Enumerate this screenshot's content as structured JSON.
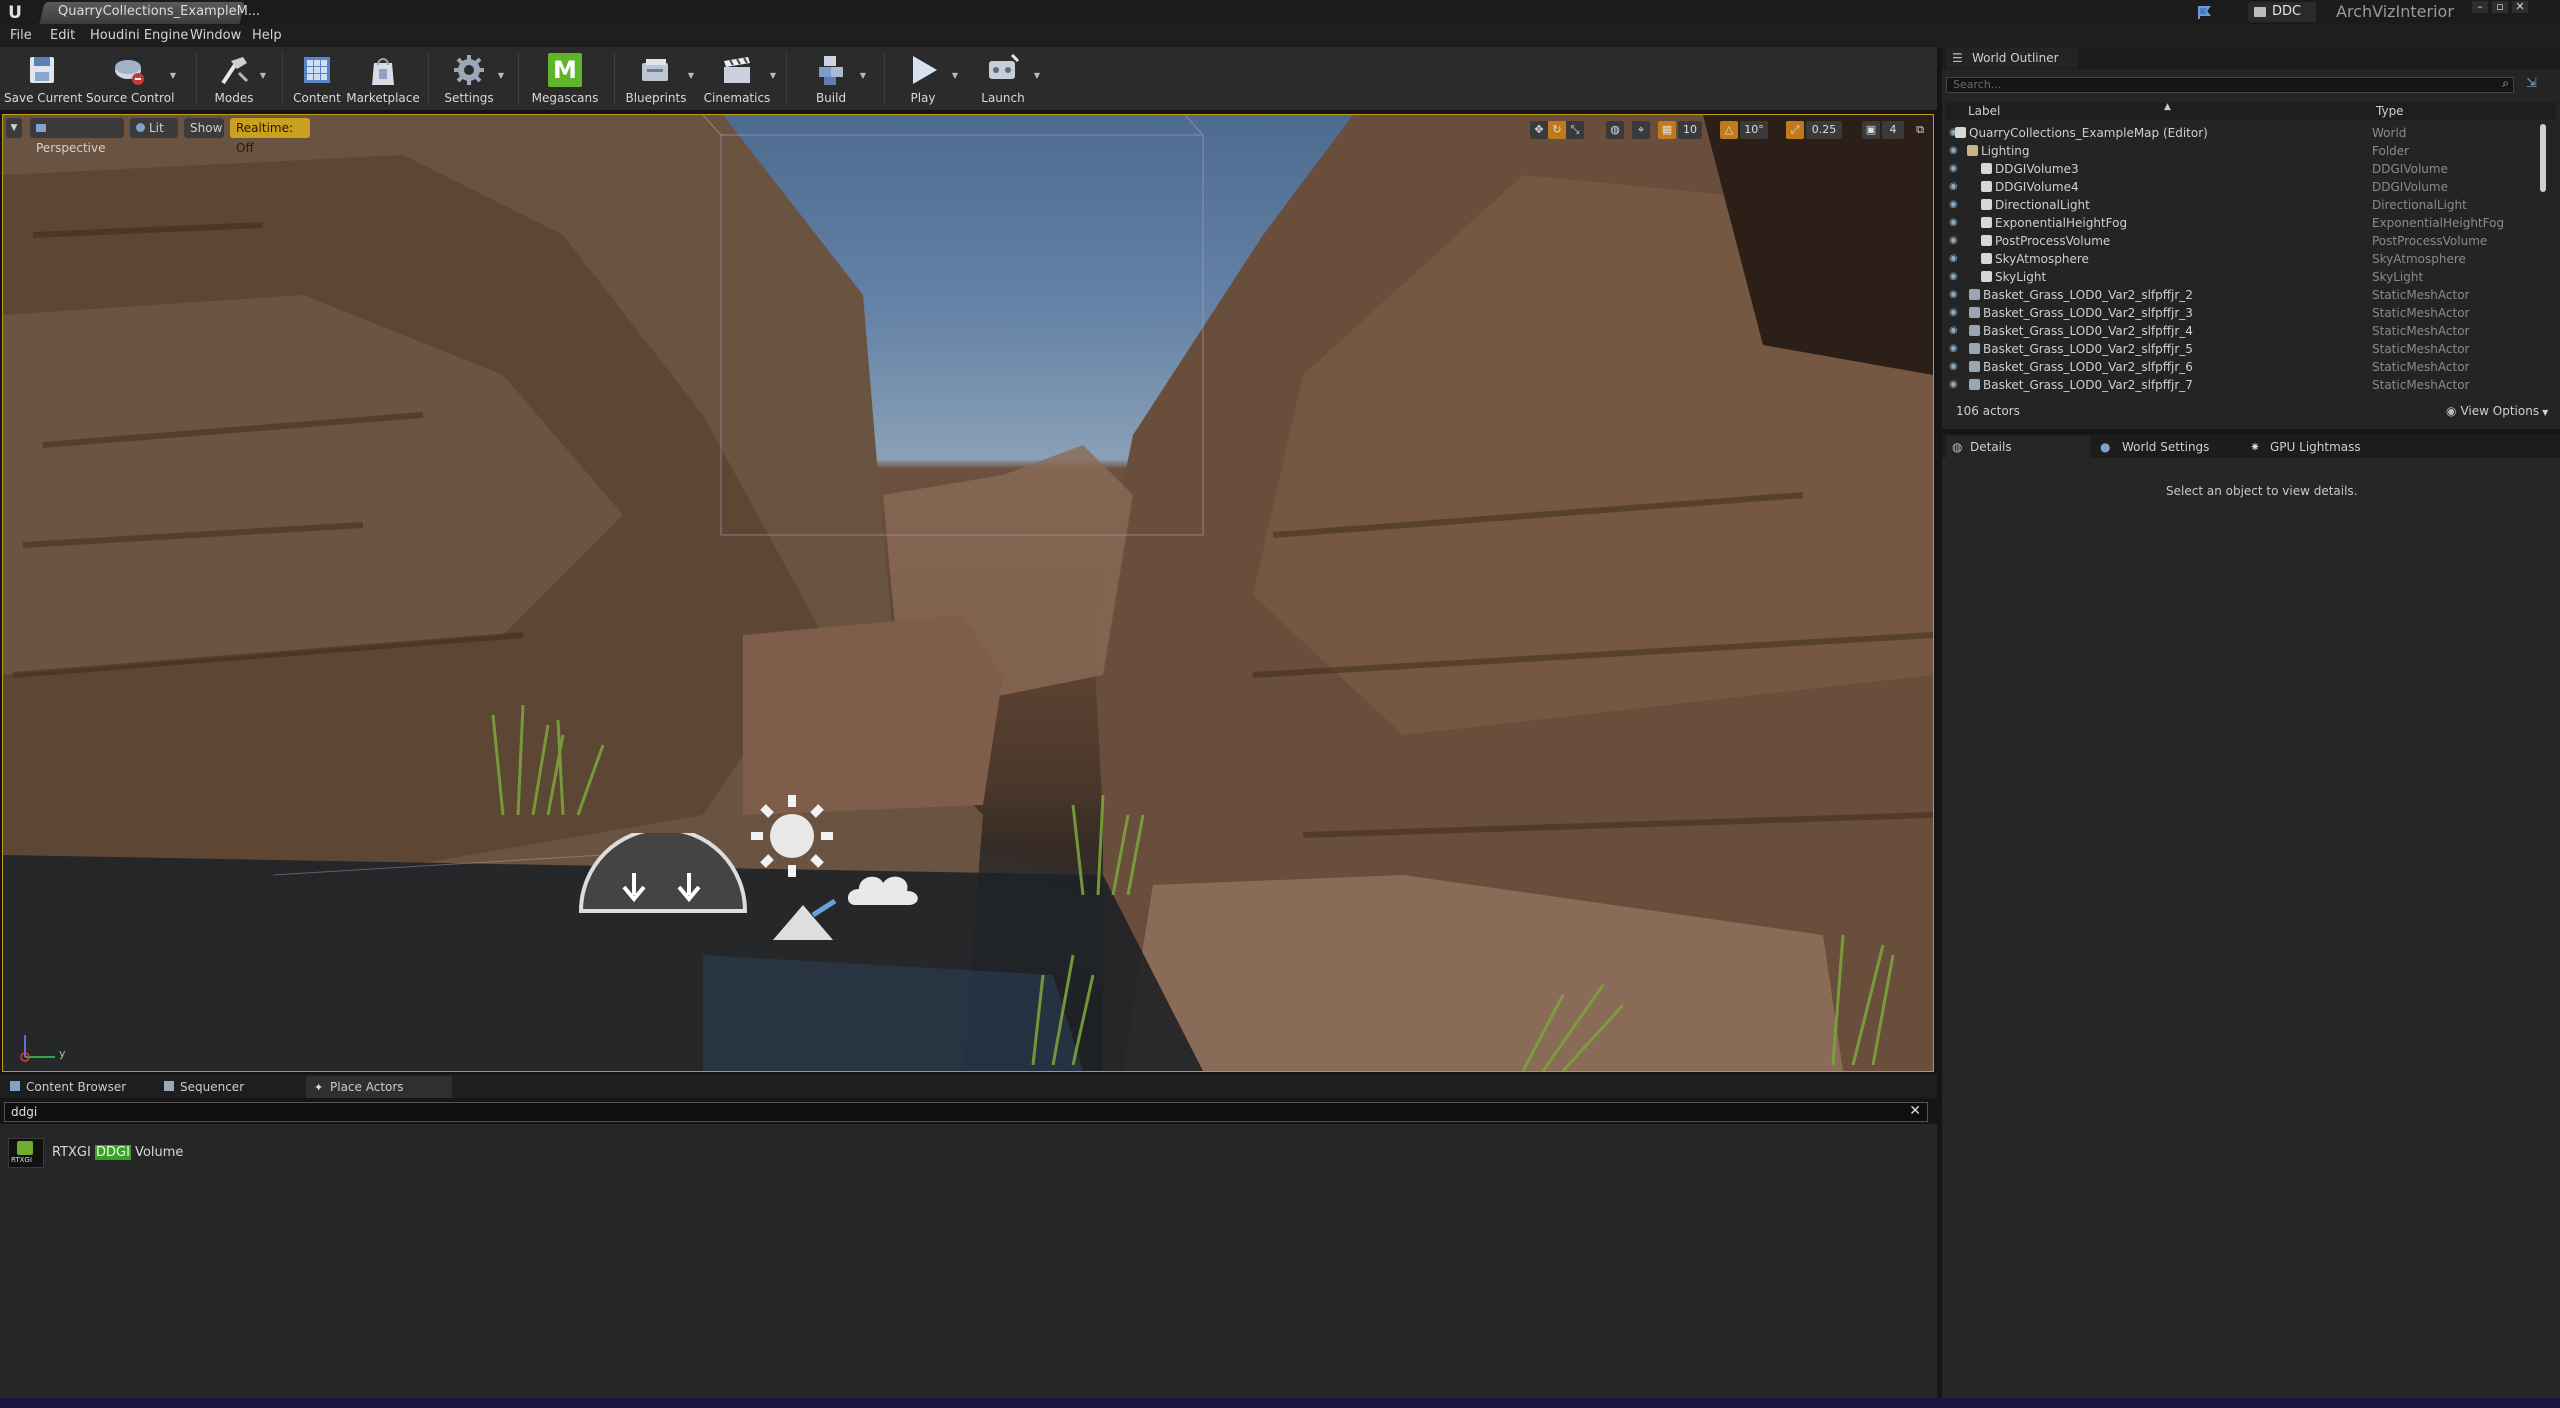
{
  "titlebar": {
    "document_tab": "QuarryCollections_ExampleM...",
    "ddc_label": "DDC",
    "project_name": "ArchVizInterior"
  },
  "menu": [
    "File",
    "Edit",
    "Houdini Engine",
    "Window",
    "Help"
  ],
  "toolbar": {
    "save_current": "Save Current",
    "source_control": "Source Control",
    "modes": "Modes",
    "content": "Content",
    "marketplace": "Marketplace",
    "settings": "Settings",
    "megascans": "Megascans",
    "blueprints": "Blueprints",
    "cinematics": "Cinematics",
    "build": "Build",
    "play": "Play",
    "launch": "Launch"
  },
  "viewport": {
    "perspective": "Perspective",
    "lit": "Lit",
    "show": "Show",
    "realtime": "Realtime: Off",
    "grid_snap": "10",
    "rotation_snap": "10°",
    "scale_snap": "0.25",
    "camera_speed": "4",
    "axis_y": "y"
  },
  "bottom": {
    "tabs": [
      "Content Browser",
      "Sequencer",
      "Place Actors"
    ],
    "search_value": "ddgi",
    "result_prefix": "RTXGI ",
    "result_highlight": "DDGI",
    "result_suffix": " Volume",
    "result_icon_text": "RTXGI"
  },
  "outliner": {
    "title": "World Outliner",
    "search_placeholder": "Search...",
    "col_label": "Label",
    "col_type": "Type",
    "rows": [
      {
        "label": "QuarryCollections_ExampleMap (Editor)",
        "type": "World"
      },
      {
        "label": "Lighting",
        "type": "Folder"
      },
      {
        "label": "DDGIVolume3",
        "type": "DDGIVolume"
      },
      {
        "label": "DDGIVolume4",
        "type": "DDGIVolume"
      },
      {
        "label": "DirectionalLight",
        "type": "DirectionalLight"
      },
      {
        "label": "ExponentialHeightFog",
        "type": "ExponentialHeightFog"
      },
      {
        "label": "PostProcessVolume",
        "type": "PostProcessVolume"
      },
      {
        "label": "SkyAtmosphere",
        "type": "SkyAtmosphere"
      },
      {
        "label": "SkyLight",
        "type": "SkyLight"
      },
      {
        "label": "Basket_Grass_LOD0_Var2_slfpffjr_2",
        "type": "StaticMeshActor"
      },
      {
        "label": "Basket_Grass_LOD0_Var2_slfpffjr_3",
        "type": "StaticMeshActor"
      },
      {
        "label": "Basket_Grass_LOD0_Var2_slfpffjr_4",
        "type": "StaticMeshActor"
      },
      {
        "label": "Basket_Grass_LOD0_Var2_slfpffjr_5",
        "type": "StaticMeshActor"
      },
      {
        "label": "Basket_Grass_LOD0_Var2_slfpffjr_6",
        "type": "StaticMeshActor"
      },
      {
        "label": "Basket_Grass_LOD0_Var2_slfpffjr_7",
        "type": "StaticMeshActor"
      }
    ],
    "actor_count": "106 actors",
    "view_options": "View Options"
  },
  "details": {
    "tabs": [
      "Details",
      "World Settings",
      "GPU Lightmass"
    ],
    "empty_message": "Select an object to view details."
  },
  "colors": {
    "accent_gold": "#c09a1c",
    "megascans_green": "#5fb52a",
    "highlight_green": "#3aa02a"
  }
}
